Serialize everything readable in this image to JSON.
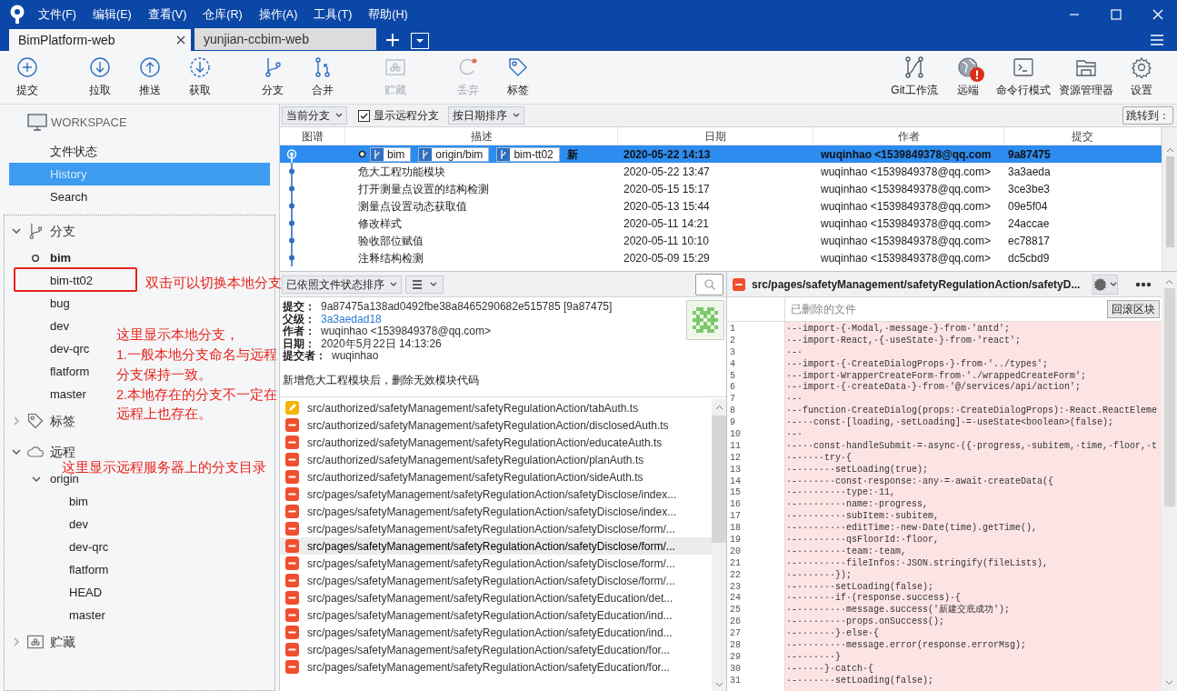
{
  "menu": [
    "文件(F)",
    "编辑(E)",
    "查看(V)",
    "仓库(R)",
    "操作(A)",
    "工具(T)",
    "帮助(H)"
  ],
  "tabs": [
    {
      "label": "BimPlatform-web",
      "selected": true
    },
    {
      "label": "yunjian-ccbim-web",
      "selected": false
    }
  ],
  "toolbar": [
    {
      "label": "提交",
      "kind": "commit",
      "disabled": false
    },
    {
      "label": "拉取",
      "kind": "pull",
      "disabled": false
    },
    {
      "label": "推送",
      "kind": "push",
      "disabled": false
    },
    {
      "label": "获取",
      "kind": "fetch",
      "disabled": false
    },
    {
      "label": "分支",
      "kind": "branch",
      "disabled": false
    },
    {
      "label": "合并",
      "kind": "merge",
      "disabled": false
    },
    {
      "label": "贮藏",
      "kind": "stash",
      "disabled": true
    },
    {
      "label": "丢弃",
      "kind": "discard",
      "disabled": true
    },
    {
      "label": "标签",
      "kind": "tag",
      "disabled": false
    }
  ],
  "toolbar_right": [
    {
      "label": "Git工作流",
      "kind": "gitflow",
      "alert": false
    },
    {
      "label": "远端",
      "kind": "remote",
      "alert": true
    },
    {
      "label": "命令行模式",
      "kind": "terminal",
      "alert": false
    },
    {
      "label": "资源管理器",
      "kind": "explorer",
      "alert": false
    },
    {
      "label": "设置",
      "kind": "settings",
      "alert": false
    }
  ],
  "sidebar": {
    "workspace": "WORKSPACE",
    "items": [
      {
        "label": "文件状态",
        "selected": false
      },
      {
        "label": "History",
        "selected": true
      },
      {
        "label": "Search",
        "selected": false
      }
    ],
    "groups": [
      {
        "label": "分支",
        "kind": "branch",
        "expanded": true,
        "children": [
          {
            "label": "bim",
            "current": true
          },
          {
            "label": "bim-tt02",
            "current": false
          },
          {
            "label": "bug",
            "current": false
          },
          {
            "label": "dev",
            "current": false
          },
          {
            "label": "dev-qrc",
            "current": false
          },
          {
            "label": "flatform",
            "current": false
          },
          {
            "label": "master",
            "current": false
          }
        ]
      },
      {
        "label": "标签",
        "kind": "tag",
        "expanded": false
      },
      {
        "label": "远程",
        "kind": "cloud",
        "expanded": true,
        "children": [
          {
            "label": "origin",
            "expanded": true,
            "children": [
              {
                "label": "bim"
              },
              {
                "label": "dev"
              },
              {
                "label": "dev-qrc"
              },
              {
                "label": "flatform"
              },
              {
                "label": "HEAD"
              },
              {
                "label": "master"
              }
            ]
          }
        ]
      },
      {
        "label": "贮藏",
        "kind": "stash",
        "expanded": false
      }
    ]
  },
  "history": {
    "branch_filter": "当前分支",
    "show_remote": {
      "label": "显示远程分支",
      "checked": true
    },
    "sort": "按日期排序",
    "jump": "跳转到：",
    "columns": [
      "图谱",
      "描述",
      "日期",
      "作者",
      "提交"
    ],
    "rows": [
      {
        "selected": true,
        "refs": [
          {
            "label": "bim",
            "current": true
          },
          {
            "label": "origin/bim",
            "current": false
          },
          {
            "label": "bim-tt02",
            "current": false
          }
        ],
        "description": "新",
        "date": "2020-05-22 14:13",
        "author": "wuqinhao <1539849378@qq.com",
        "commit": "9a87475"
      },
      {
        "selected": false,
        "description": "危大工程功能模块",
        "date": "2020-05-22 13:47",
        "author": "wuqinhao <1539849378@qq.com>",
        "commit": "3a3aeda"
      },
      {
        "selected": false,
        "description": "打开测量点设置的结构检测",
        "date": "2020-05-15 15:17",
        "author": "wuqinhao <1539849378@qq.com>",
        "commit": "3ce3be3"
      },
      {
        "selected": false,
        "description": "测量点设置动态获取值",
        "date": "2020-05-13 15:44",
        "author": "wuqinhao <1539849378@qq.com>",
        "commit": "09e5f04"
      },
      {
        "selected": false,
        "description": "修改样式",
        "date": "2020-05-11 14:21",
        "author": "wuqinhao <1539849378@qq.com>",
        "commit": "24accae"
      },
      {
        "selected": false,
        "description": "验收部位赋值",
        "date": "2020-05-11 10:10",
        "author": "wuqinhao <1539849378@qq.com>",
        "commit": "ec78817"
      },
      {
        "selected": false,
        "description": "注释结构检测",
        "date": "2020-05-09 15:29",
        "author": "wuqinhao <1539849378@qq.com>",
        "commit": "dc5cbd9"
      }
    ]
  },
  "details": {
    "sort": "已依照文件状态排序",
    "fields": [
      {
        "label": "提交：",
        "value": "9a87475a138ad0492fbe38a8465290682e515785 [9a87475]",
        "kind": "text"
      },
      {
        "label": "父级：",
        "value": "3a3aedad18",
        "kind": "link"
      },
      {
        "label": "作者：",
        "value": "wuqinhao <1539849378@qq.com>",
        "kind": "text"
      },
      {
        "label": "日期：",
        "value": "2020年5月22日 14:13:26",
        "kind": "text"
      },
      {
        "label": "提交者：",
        "value": "wuqinhao",
        "kind": "text"
      }
    ],
    "message": "新增危大工程模块后，删除无效模块代码",
    "files": [
      {
        "kind": "modified",
        "selected": false,
        "path": "src/authorized/safetyManagement/safetyRegulationAction/tabAuth.ts"
      },
      {
        "kind": "removed",
        "selected": false,
        "path": "src/authorized/safetyManagement/safetyRegulationAction/disclosedAuth.ts"
      },
      {
        "kind": "removed",
        "selected": false,
        "path": "src/authorized/safetyManagement/safetyRegulationAction/educateAuth.ts"
      },
      {
        "kind": "removed",
        "selected": false,
        "path": "src/authorized/safetyManagement/safetyRegulationAction/planAuth.ts"
      },
      {
        "kind": "removed",
        "selected": false,
        "path": "src/authorized/safetyManagement/safetyRegulationAction/sideAuth.ts"
      },
      {
        "kind": "removed",
        "selected": false,
        "path": "src/pages/safetyManagement/safetyRegulationAction/safetyDisclose/index..."
      },
      {
        "kind": "removed",
        "selected": false,
        "path": "src/pages/safetyManagement/safetyRegulationAction/safetyDisclose/index..."
      },
      {
        "kind": "removed",
        "selected": false,
        "path": "src/pages/safetyManagement/safetyRegulationAction/safetyDisclose/form/..."
      },
      {
        "kind": "removed",
        "selected": true,
        "path": "src/pages/safetyManagement/safetyRegulationAction/safetyDisclose/form/..."
      },
      {
        "kind": "removed",
        "selected": false,
        "path": "src/pages/safetyManagement/safetyRegulationAction/safetyDisclose/form/..."
      },
      {
        "kind": "removed",
        "selected": false,
        "path": "src/pages/safetyManagement/safetyRegulationAction/safetyDisclose/form/..."
      },
      {
        "kind": "removed",
        "selected": false,
        "path": "src/pages/safetyManagement/safetyRegulationAction/safetyEducation/det..."
      },
      {
        "kind": "removed",
        "selected": false,
        "path": "src/pages/safetyManagement/safetyRegulationAction/safetyEducation/ind..."
      },
      {
        "kind": "removed",
        "selected": false,
        "path": "src/pages/safetyManagement/safetyRegulationAction/safetyEducation/ind..."
      },
      {
        "kind": "removed",
        "selected": false,
        "path": "src/pages/safetyManagement/safetyRegulationAction/safetyEducation/for..."
      },
      {
        "kind": "removed",
        "selected": false,
        "path": "src/pages/safetyManagement/safetyRegulationAction/safetyEducation/for..."
      }
    ]
  },
  "diff": {
    "kind": "removed",
    "file": "src/pages/safetyManagement/safetyRegulationAction/safetyD...",
    "header": "已删除的文件",
    "button": "回滚区块",
    "lines": [
      {
        "num": "1",
        "text": "·-·import·{·Modal,·message·}·from·'antd';"
      },
      {
        "num": "2",
        "text": "·-·import·React,·{·useState·}·from·'react';"
      },
      {
        "num": "3",
        "text": "·-·"
      },
      {
        "num": "4",
        "text": "·-·import·{·CreateDialogProps·}·from·'../types';"
      },
      {
        "num": "5",
        "text": "·-·import·WrapperCreateForm·from·'./wrappedCreateForm';"
      },
      {
        "num": "6",
        "text": "·-·import·{·createData·}·from·'@/services/api/action';"
      },
      {
        "num": "7",
        "text": "·-·"
      },
      {
        "num": "8",
        "text": "·-·function·CreateDialog(props:·CreateDialogProps):·React.ReactEleme"
      },
      {
        "num": "9",
        "text": "·-···const·[loading,·setLoading]·=·useState<boolean>(false);"
      },
      {
        "num": "10",
        "text": "·-·"
      },
      {
        "num": "11",
        "text": "·-···const·handleSubmit·=·async·({·progress,·subitem,·time,·floor,·t"
      },
      {
        "num": "12",
        "text": "·-·····try·{"
      },
      {
        "num": "13",
        "text": "·-·······setLoading(true);"
      },
      {
        "num": "14",
        "text": "·-·······const·response:·any·=·await·createData({"
      },
      {
        "num": "15",
        "text": "·-·········type:·11,"
      },
      {
        "num": "16",
        "text": "·-·········name:·progress,"
      },
      {
        "num": "17",
        "text": "·-·········subItem:·subitem,"
      },
      {
        "num": "18",
        "text": "·-·········editTime:·new·Date(time).getTime(),"
      },
      {
        "num": "19",
        "text": "·-·········qsFloorId:·floor,"
      },
      {
        "num": "20",
        "text": "·-·········team:·team,"
      },
      {
        "num": "21",
        "text": "·-·········fileInfos:·JSON.stringify(fileLists),"
      },
      {
        "num": "22",
        "text": "·-·······});"
      },
      {
        "num": "23",
        "text": "·-·······setLoading(false);"
      },
      {
        "num": "24",
        "text": "·-·······if·(response.success)·{"
      },
      {
        "num": "25",
        "text": "·-·········message.success('新建交底成功');"
      },
      {
        "num": "26",
        "text": "·-·········props.onSuccess();"
      },
      {
        "num": "27",
        "text": "·-·······}·else·{"
      },
      {
        "num": "28",
        "text": "·-·········message.error(response.errorMsg);"
      },
      {
        "num": "29",
        "text": "·-·······}"
      },
      {
        "num": "30",
        "text": "·-·····}·catch·{"
      },
      {
        "num": "31",
        "text": "·-·······setLoading(false);"
      }
    ]
  },
  "annotations": {
    "highlight_box": true,
    "notes": [
      "双击可以切换本地分支",
      "这里显示本地分支，",
      "1.一般本地分支命名与远程",
      "分支保持一致。",
      "2.本地存在的分支不一定在",
      "远程上也存在。",
      "这里显示远程服务器上的分支目录"
    ]
  }
}
